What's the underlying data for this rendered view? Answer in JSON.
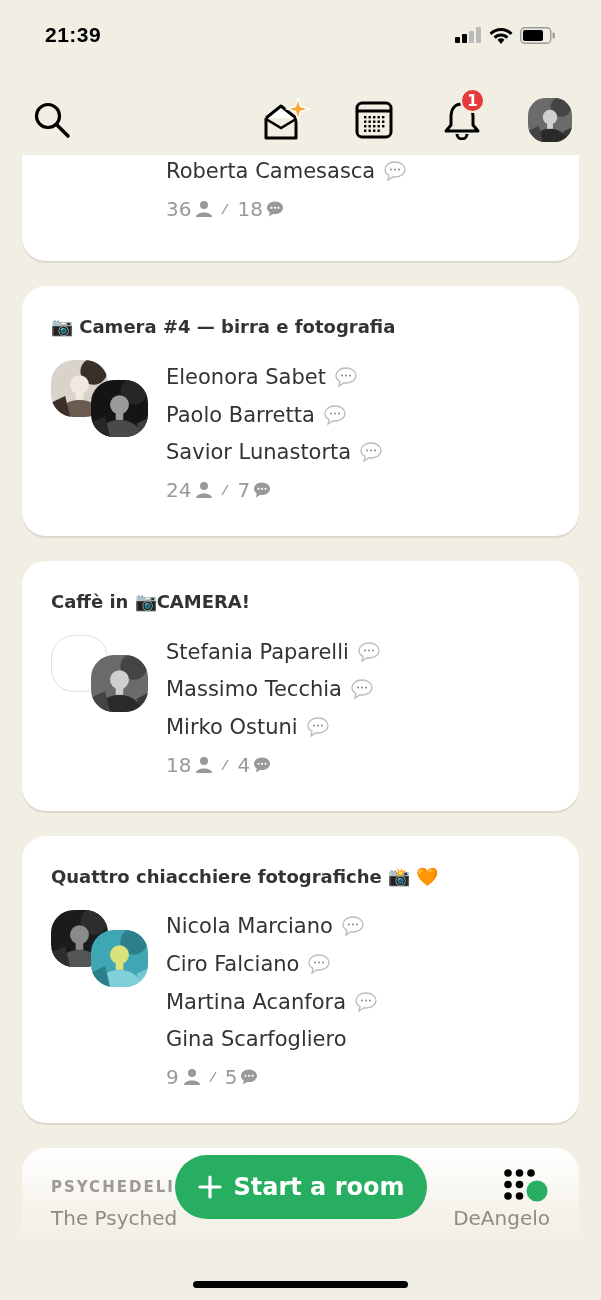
{
  "status_bar": {
    "time": "21:39"
  },
  "header": {
    "notification_count": "1"
  },
  "rooms": [
    {
      "kind": "partial",
      "speakers": [
        {
          "name": "Roberta Camesasca",
          "chat": true
        }
      ],
      "listeners": "36",
      "messages": "18"
    },
    {
      "kind": "full",
      "title": "📷 Camera #4 — birra e fotografia",
      "avatars": [
        {
          "kind": "picture"
        },
        {
          "kind": "picture"
        }
      ],
      "speakers": [
        {
          "name": "Eleonora Sabet",
          "chat": true
        },
        {
          "name": "Paolo Barretta",
          "chat": true
        },
        {
          "name": "Savior Lunastorta",
          "chat": true
        }
      ],
      "listeners": "24",
      "messages": "7"
    },
    {
      "kind": "full",
      "title": "Caffè in 📷CAMERA!",
      "avatars": [
        {
          "kind": "empty"
        },
        {
          "kind": "picture"
        }
      ],
      "speakers": [
        {
          "name": "Stefania Paparelli",
          "chat": true
        },
        {
          "name": "Massimo Tecchia",
          "chat": true
        },
        {
          "name": "Mirko Ostuni",
          "chat": true
        }
      ],
      "listeners": "18",
      "messages": "4"
    },
    {
      "kind": "full",
      "title": "Quattro chiacchiere fotografiche 📸 🧡",
      "avatars": [
        {
          "kind": "picture"
        },
        {
          "kind": "picture"
        }
      ],
      "speakers": [
        {
          "name": "Nicola Marciano",
          "chat": true
        },
        {
          "name": "Ciro Falciano",
          "chat": true
        },
        {
          "name": "Martina Acanfora",
          "chat": true
        },
        {
          "name": "Gina Scarfogliero",
          "chat": false
        }
      ],
      "listeners": "9",
      "messages": "5"
    },
    {
      "kind": "teaser",
      "club": "PSYCHEDELI",
      "title_start": "The Psyched",
      "title_end": "DeAngelo"
    }
  ],
  "start_button": {
    "label": "Start a room"
  }
}
